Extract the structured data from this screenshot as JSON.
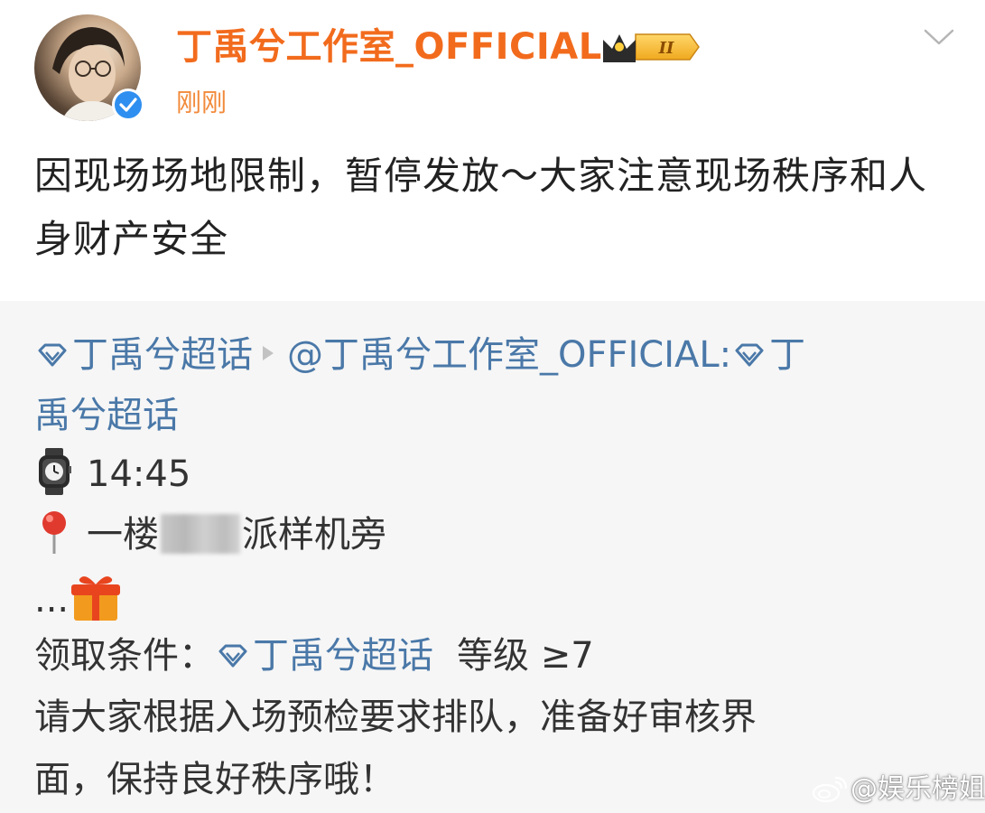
{
  "post": {
    "author": "丁禹兮工作室_OFFICIAL",
    "member_badge": "II",
    "time": "刚刚",
    "text": "因现场场地限制，暂停发放～大家注意现场秩序和人身财产安全"
  },
  "repost": {
    "topic_1": "丁禹兮超话",
    "mention": "@丁禹兮工作室_OFFICIAL:",
    "topic_2_part1": "丁",
    "topic_2_part2": "禹兮超话",
    "time_value": "14:45",
    "location_prefix": "一楼",
    "location_suffix": "派样机旁",
    "ellipsis": "...",
    "condition_label": "领取条件：",
    "condition_topic": "丁禹兮超话",
    "condition_level": "等级 ≥7",
    "notice_line1": "请大家根据入场预检要求排队，准备好审核界",
    "notice_line2": "面，保持良好秩序哦！"
  },
  "watermark": "@娱乐榜姐",
  "icons": {
    "verified": "verified-icon",
    "crown": "crown-badge-icon",
    "chevron": "chevron-down-icon",
    "diamond": "super-topic-diamond-icon",
    "watch": "watch-icon",
    "pin": "pin-icon",
    "gift": "gift-icon",
    "weibo": "weibo-logo-icon"
  },
  "colors": {
    "author": "#f26b1d",
    "time": "#f28a3a",
    "link": "#4a78a8",
    "verified": "#2f8ff0",
    "card_bg": "#f6f6f6"
  }
}
